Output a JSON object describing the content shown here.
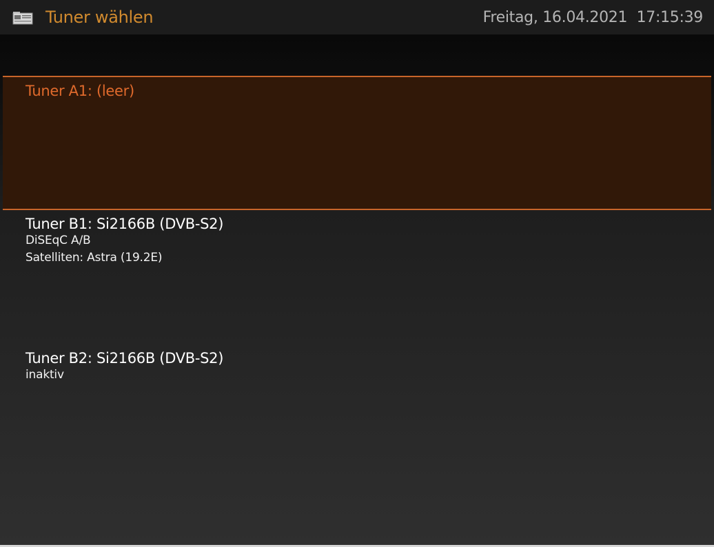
{
  "header": {
    "icon": "tuner-card-icon",
    "title": "Tuner wählen",
    "datetime": "Freitag, 16.04.2021  17:15:39"
  },
  "tuners": [
    {
      "title": "Tuner A1: (leer)",
      "lines": [],
      "selected": true
    },
    {
      "title": "Tuner B1: Si2166B (DVB-S2)",
      "lines": [
        "DiSEqC A/B",
        "Satelliten: Astra (19.2E)"
      ],
      "selected": false
    },
    {
      "title": "Tuner B2: Si2166B (DVB-S2)",
      "lines": [
        "inaktiv"
      ],
      "selected": false
    }
  ],
  "colors": {
    "accent": "#d18a2e",
    "selection_border": "#c9652a",
    "selection_bg": "#311808",
    "selected_text": "#e06a2c"
  }
}
